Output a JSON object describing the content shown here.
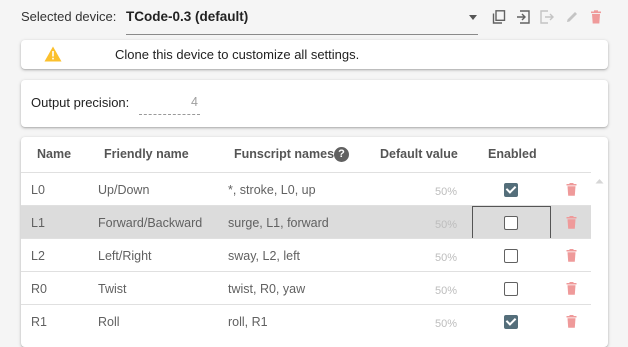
{
  "device": {
    "label": "Selected device:",
    "value": "TCode-0.3 (default)"
  },
  "toolbar": {
    "icons": [
      "clone-icon",
      "import-icon",
      "export-icon",
      "edit-icon",
      "delete-icon"
    ]
  },
  "notice": {
    "text": "Clone this device to customize all settings.",
    "icon": "warning-icon",
    "color": "#fbc02d"
  },
  "precision": {
    "label": "Output precision:",
    "value": "4"
  },
  "table": {
    "headers": {
      "name": "Name",
      "friendly": "Friendly name",
      "funscript": "Funscript names",
      "default": "Default value",
      "enabled": "Enabled"
    },
    "rows": [
      {
        "name": "L0",
        "friendly": "Up/Down",
        "funscript": "*, stroke, L0, up",
        "default": "50%",
        "enabled": true
      },
      {
        "name": "L1",
        "friendly": "Forward/Backward",
        "funscript": "surge, L1, forward",
        "default": "50%",
        "enabled": false
      },
      {
        "name": "L2",
        "friendly": "Left/Right",
        "funscript": "sway, L2, left",
        "default": "50%",
        "enabled": false
      },
      {
        "name": "R0",
        "friendly": "Twist",
        "funscript": "twist, R0, yaw",
        "default": "50%",
        "enabled": false
      },
      {
        "name": "R1",
        "friendly": "Roll",
        "funscript": "roll, R1",
        "default": "50%",
        "enabled": true
      }
    ]
  },
  "colors": {
    "checkbox_on": "#546e7a",
    "delete": "#ef9a9a",
    "selected_row": "#dcdcdc"
  }
}
